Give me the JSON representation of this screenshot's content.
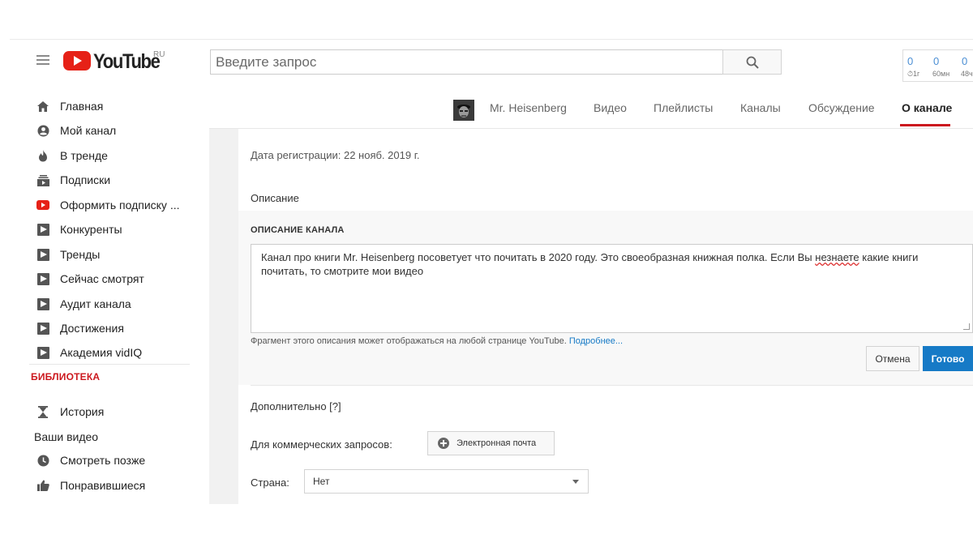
{
  "header": {
    "logo_text": "YouTube",
    "logo_region": "RU",
    "search_placeholder": "Введите запрос",
    "stats": [
      {
        "value": "0",
        "label": "⏱1г"
      },
      {
        "value": "0",
        "label": "60мн"
      },
      {
        "value": "0",
        "label": "48ч"
      }
    ]
  },
  "sidebar": {
    "items": [
      {
        "label": "Главная",
        "icon": "home-icon"
      },
      {
        "label": "Мой канал",
        "icon": "account-icon"
      },
      {
        "label": "В тренде",
        "icon": "flame-icon"
      },
      {
        "label": "Подписки",
        "icon": "subscriptions-icon"
      },
      {
        "label": "Оформить подписку ...",
        "icon": "youtube-red-icon"
      },
      {
        "label": "Конкуренты",
        "icon": "vidiq-icon"
      },
      {
        "label": "Тренды",
        "icon": "vidiq-icon"
      },
      {
        "label": "Сейчас смотрят",
        "icon": "vidiq-icon"
      },
      {
        "label": "Аудит канала",
        "icon": "vidiq-icon"
      },
      {
        "label": "Достижения",
        "icon": "vidiq-icon"
      },
      {
        "label": "Академия vidIQ",
        "icon": "vidiq-icon"
      }
    ],
    "library_heading": "БИБЛИОТЕКА",
    "library_items": [
      {
        "label": "История",
        "icon": "hourglass-icon"
      }
    ],
    "your_videos": "Ваши видео",
    "more_items": [
      {
        "label": "Смотреть позже",
        "icon": "clock-icon"
      },
      {
        "label": "Понравившиеся",
        "icon": "thumbs-up-icon"
      }
    ]
  },
  "channel_tabs": {
    "channel_name": "Mr. Heisenberg",
    "tabs": [
      "Видео",
      "Плейлисты",
      "Каналы",
      "Обсуждение",
      "О канале"
    ],
    "active_tab": "О канале"
  },
  "about": {
    "registration": "Дата регистрации: 22 нояб. 2019 г.",
    "description_heading": "Описание",
    "description_label": "ОПИСАНИЕ КАНАЛА",
    "description_text_part1": "Канал про книги Mr. Heisenberg посоветует что почитать в 2020 году. Это своеобразная книжная полка.  Если Вы ",
    "description_text_err": "незнаете",
    "description_text_part2": " какие книги почитать, то смотрите мои видео",
    "hint_text": "Фрагмент этого описания может отображаться на любой странице YouTube. ",
    "hint_link": "Подробнее...",
    "cancel_label": "Отмена",
    "save_label": "Готово",
    "additional_heading": "Дополнительно [?]",
    "business_label": "Для коммерческих запросов:",
    "email_button_label": "Электронная почта",
    "country_label": "Страна:",
    "country_value": "Нет"
  },
  "colors": {
    "accent_red": "#cc181e",
    "link_blue": "#167ac6",
    "stats_blue": "#4b8fd4"
  }
}
